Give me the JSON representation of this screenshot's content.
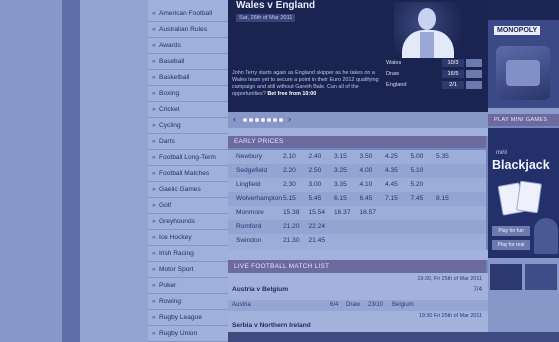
{
  "sidebar": {
    "bullet": "»",
    "items": [
      "American Football",
      "Australian Rules",
      "Awards",
      "Baseball",
      "Basketball",
      "Boxing",
      "Cricket",
      "Cycling",
      "Darts",
      "Football Long-Term",
      "Football Matches",
      "Gaelic Games",
      "Golf",
      "Greyhounds",
      "Ice Hockey",
      "Irish Racing",
      "Motor Sport",
      "Poker",
      "Rowing",
      "Rugby League",
      "Rugby Union"
    ]
  },
  "feature": {
    "title": "Wales v England",
    "date": "Sat, 26th of Mar 2011",
    "text": "John Terry starts again as England skipper as he takes on a Wales team yet to secure a point in their Euro 2012 qualifying campaign and still without Gareth Bale. Can all of the opportunities? ",
    "cta": "Bet free from 10:00",
    "odds": [
      {
        "team": "Wales",
        "price": "10/3"
      },
      {
        "team": "Draw",
        "price": "16/5"
      },
      {
        "team": "England",
        "price": "2/1"
      }
    ],
    "carousel": {
      "prev": "‹",
      "next": "›",
      "dot_count": 7
    }
  },
  "early_prices": {
    "header": "EARLY PRICES",
    "rows": [
      {
        "venue": "Newbury",
        "times": [
          "2.10",
          "2.40",
          "3.15",
          "3.50",
          "4.25",
          "5.00",
          "5.35"
        ]
      },
      {
        "venue": "Sedgefield",
        "times": [
          "2.20",
          "2.50",
          "3.25",
          "4.00",
          "4.35",
          "5.10"
        ]
      },
      {
        "venue": "Lingfield",
        "times": [
          "2.30",
          "3.00",
          "3.35",
          "4.10",
          "4.45",
          "5.20"
        ]
      },
      {
        "venue": "Wolverhampton",
        "times": [
          "5.15",
          "5.45",
          "6.15",
          "6.45",
          "7.15",
          "7.45",
          "8.15"
        ]
      },
      {
        "venue": "Monmore",
        "times": [
          "15.38",
          "15.54",
          "16.37",
          "16.57"
        ]
      },
      {
        "venue": "Romford",
        "times": [
          "21.20",
          "22.24"
        ]
      },
      {
        "venue": "Swindon",
        "times": [
          "21.30",
          "21.45"
        ]
      }
    ]
  },
  "live_list": {
    "header": "LIVE FOOTBALL MATCH LIST",
    "match_1": {
      "datetime": "19:30, Fri 25th of Mar 2011",
      "title": "Austria v Belgium",
      "more": "7/4",
      "home": "Austria",
      "home_price": "6/4",
      "draw": "Draw",
      "draw_price": "23/10",
      "away": "Belgium"
    },
    "match_2": {
      "datetime": "19:30 Fri 25th of Mar 2011",
      "title": "Serbia v Northern Ireland"
    }
  },
  "right_column": {
    "promo_logo": "MONOPOLY",
    "games_header": "PLAY MINI GAMES",
    "blackjack": {
      "mini": "mini",
      "title": "Blackjack",
      "play_fun": "Play for fun",
      "play_real": "Play for real"
    }
  },
  "colors": {
    "feature_bg": "#1b2450",
    "section_header": "#6d6a9f",
    "sidebar_bg": "#9fb0da"
  }
}
